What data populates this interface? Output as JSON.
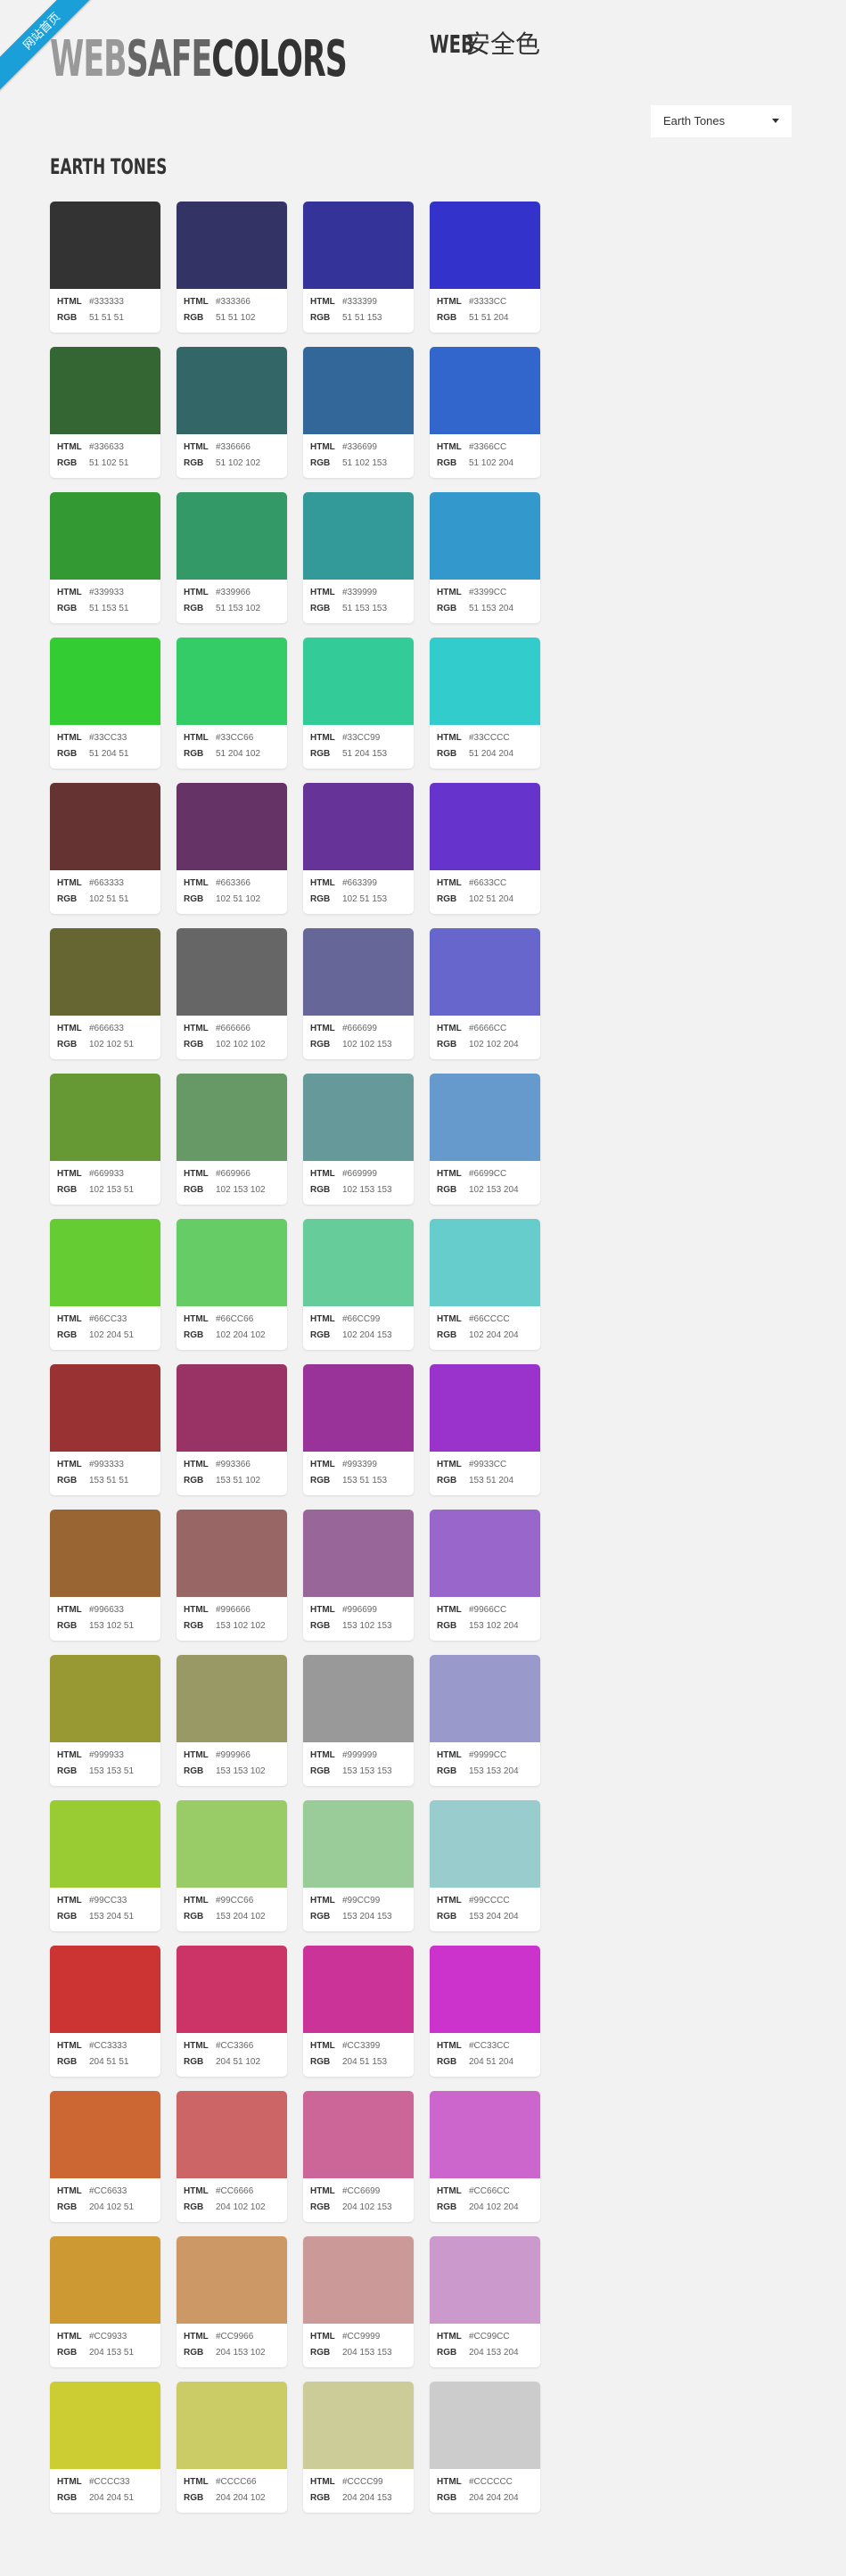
{
  "ribbon": {
    "text": "网站首页"
  },
  "logo": {
    "part1": "WEB",
    "part2": "SAFE",
    "part3": "COLORS"
  },
  "subtitle": {
    "part1": "WEB",
    "part2": "安全色"
  },
  "select": {
    "value": "Earth Tones",
    "icon": "chevron-down-icon"
  },
  "section": {
    "title": "EARTH TONES"
  },
  "labels": {
    "html": "HTML",
    "rgb": "RGB"
  },
  "colors": [
    {
      "hex": "#333333",
      "rgb": "51 51 51"
    },
    {
      "hex": "#333366",
      "rgb": "51 51 102"
    },
    {
      "hex": "#333399",
      "rgb": "51 51 153"
    },
    {
      "hex": "#3333CC",
      "rgb": "51 51 204"
    },
    {
      "hex": "#336633",
      "rgb": "51 102 51"
    },
    {
      "hex": "#336666",
      "rgb": "51 102 102"
    },
    {
      "hex": "#336699",
      "rgb": "51 102 153"
    },
    {
      "hex": "#3366CC",
      "rgb": "51 102 204"
    },
    {
      "hex": "#339933",
      "rgb": "51 153 51"
    },
    {
      "hex": "#339966",
      "rgb": "51 153 102"
    },
    {
      "hex": "#339999",
      "rgb": "51 153 153"
    },
    {
      "hex": "#3399CC",
      "rgb": "51 153 204"
    },
    {
      "hex": "#33CC33",
      "rgb": "51 204 51"
    },
    {
      "hex": "#33CC66",
      "rgb": "51 204 102"
    },
    {
      "hex": "#33CC99",
      "rgb": "51 204 153"
    },
    {
      "hex": "#33CCCC",
      "rgb": "51 204 204"
    },
    {
      "hex": "#663333",
      "rgb": "102 51 51"
    },
    {
      "hex": "#663366",
      "rgb": "102 51 102"
    },
    {
      "hex": "#663399",
      "rgb": "102 51 153"
    },
    {
      "hex": "#6633CC",
      "rgb": "102 51 204"
    },
    {
      "hex": "#666633",
      "rgb": "102 102 51"
    },
    {
      "hex": "#666666",
      "rgb": "102 102 102"
    },
    {
      "hex": "#666699",
      "rgb": "102 102 153"
    },
    {
      "hex": "#6666CC",
      "rgb": "102 102 204"
    },
    {
      "hex": "#669933",
      "rgb": "102 153 51"
    },
    {
      "hex": "#669966",
      "rgb": "102 153 102"
    },
    {
      "hex": "#669999",
      "rgb": "102 153 153"
    },
    {
      "hex": "#6699CC",
      "rgb": "102 153 204"
    },
    {
      "hex": "#66CC33",
      "rgb": "102 204 51"
    },
    {
      "hex": "#66CC66",
      "rgb": "102 204 102"
    },
    {
      "hex": "#66CC99",
      "rgb": "102 204 153"
    },
    {
      "hex": "#66CCCC",
      "rgb": "102 204 204"
    },
    {
      "hex": "#993333",
      "rgb": "153 51 51"
    },
    {
      "hex": "#993366",
      "rgb": "153 51 102"
    },
    {
      "hex": "#993399",
      "rgb": "153 51 153"
    },
    {
      "hex": "#9933CC",
      "rgb": "153 51 204"
    },
    {
      "hex": "#996633",
      "rgb": "153 102 51"
    },
    {
      "hex": "#996666",
      "rgb": "153 102 102"
    },
    {
      "hex": "#996699",
      "rgb": "153 102 153"
    },
    {
      "hex": "#9966CC",
      "rgb": "153 102 204"
    },
    {
      "hex": "#999933",
      "rgb": "153 153 51"
    },
    {
      "hex": "#999966",
      "rgb": "153 153 102"
    },
    {
      "hex": "#999999",
      "rgb": "153 153 153"
    },
    {
      "hex": "#9999CC",
      "rgb": "153 153 204"
    },
    {
      "hex": "#99CC33",
      "rgb": "153 204 51"
    },
    {
      "hex": "#99CC66",
      "rgb": "153 204 102"
    },
    {
      "hex": "#99CC99",
      "rgb": "153 204 153"
    },
    {
      "hex": "#99CCCC",
      "rgb": "153 204 204"
    },
    {
      "hex": "#CC3333",
      "rgb": "204 51 51"
    },
    {
      "hex": "#CC3366",
      "rgb": "204 51 102"
    },
    {
      "hex": "#CC3399",
      "rgb": "204 51 153"
    },
    {
      "hex": "#CC33CC",
      "rgb": "204 51 204"
    },
    {
      "hex": "#CC6633",
      "rgb": "204 102 51"
    },
    {
      "hex": "#CC6666",
      "rgb": "204 102 102"
    },
    {
      "hex": "#CC6699",
      "rgb": "204 102 153"
    },
    {
      "hex": "#CC66CC",
      "rgb": "204 102 204"
    },
    {
      "hex": "#CC9933",
      "rgb": "204 153 51"
    },
    {
      "hex": "#CC9966",
      "rgb": "204 153 102"
    },
    {
      "hex": "#CC9999",
      "rgb": "204 153 153"
    },
    {
      "hex": "#CC99CC",
      "rgb": "204 153 204"
    },
    {
      "hex": "#CCCC33",
      "rgb": "204 204 51"
    },
    {
      "hex": "#CCCC66",
      "rgb": "204 204 102"
    },
    {
      "hex": "#CCCC99",
      "rgb": "204 204 153"
    },
    {
      "hex": "#CCCCCC",
      "rgb": "204 204 204"
    }
  ]
}
